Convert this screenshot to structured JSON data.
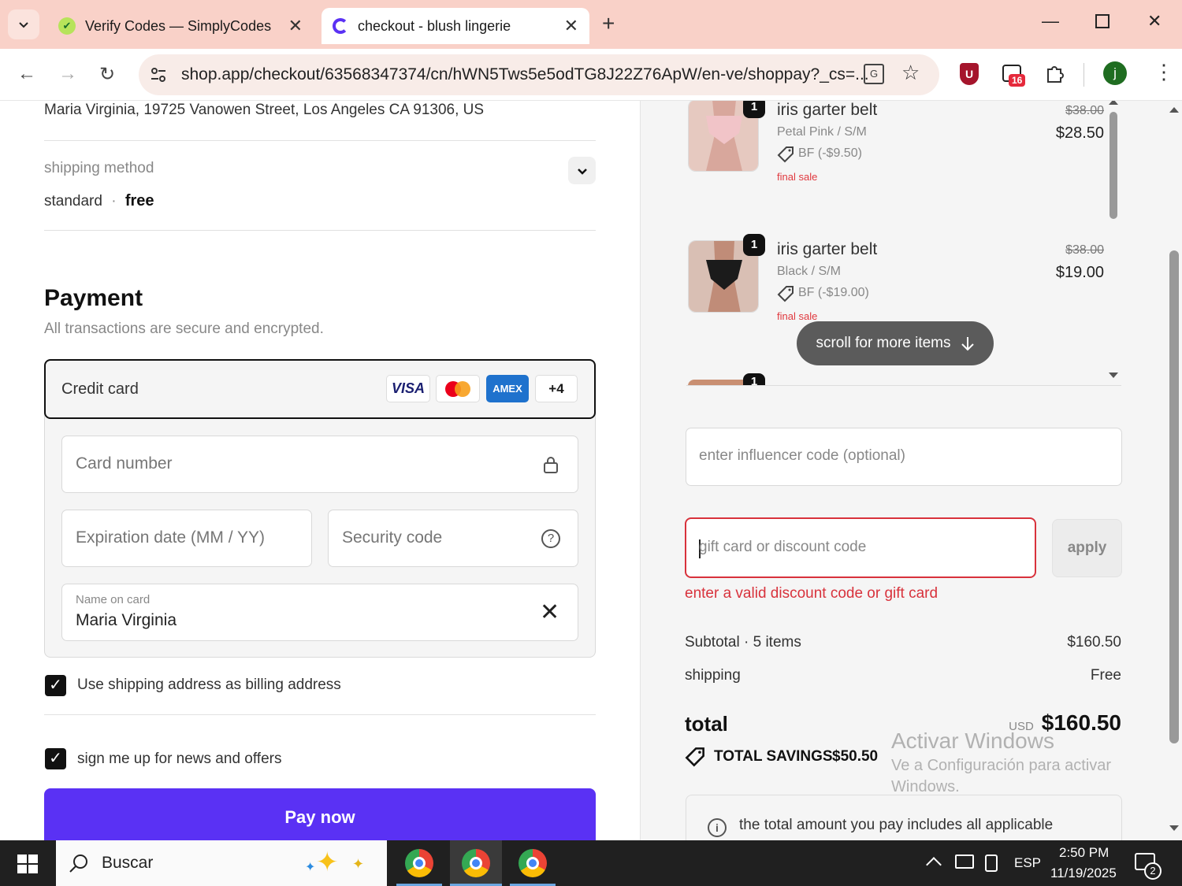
{
  "browser": {
    "tabs": [
      {
        "title": "Verify Codes — SimplyCodes",
        "favicon": "simplycodes-icon"
      },
      {
        "title": "checkout - blush lingerie",
        "favicon": "shop-icon"
      }
    ],
    "url": "shop.app/checkout/63568347374/cn/hWN5Tws5e5odTG8J22Z76ApW/en-ve/shoppay?_cs=...",
    "extension_badge": "16",
    "profile_letter": "j"
  },
  "checkout": {
    "address_line": "Maria Virginia, 19725 Vanowen Street, Los Angeles CA 91306, US",
    "shipping_method_label": "shipping method",
    "shipping_method_name": "standard",
    "shipping_method_sep": "·",
    "shipping_method_price": "free",
    "payment_heading": "Payment",
    "payment_subtitle": "All transactions are secure and encrypted.",
    "credit_card_label": "Credit card",
    "card_brands": [
      "VISA",
      "",
      "AMEX",
      "+4"
    ],
    "card_number_placeholder": "Card number",
    "expiration_placeholder": "Expiration date (MM / YY)",
    "security_placeholder": "Security code",
    "name_label": "Name on card",
    "name_value": "Maria Virginia",
    "billing_checkbox_label": "Use shipping address as billing address",
    "newsletter_checkbox_label": "sign me up for news and offers",
    "pay_button": "Pay now"
  },
  "summary": {
    "items": [
      {
        "qty": "1",
        "title": "iris garter belt",
        "variant": "Petal Pink / S/M",
        "discount": "BF (-$9.50)",
        "final": "final sale",
        "old_price": "$38.00",
        "price": "$28.50"
      },
      {
        "qty": "1",
        "title": "iris garter belt",
        "variant": "Black / S/M",
        "discount": "BF (-$19.00)",
        "final": "final sale",
        "old_price": "$38.00",
        "price": "$19.00"
      }
    ],
    "third_item_qty": "1",
    "scroll_hint": "scroll for more items",
    "influencer_placeholder": "enter influencer code (optional)",
    "discount_placeholder": "gift card or discount code",
    "apply_button": "apply",
    "discount_error": "enter a valid discount code or gift card",
    "subtotal_label": "Subtotal · 5 items",
    "subtotal_value": "$160.50",
    "shipping_label": "shipping",
    "shipping_value": "Free",
    "total_label": "total",
    "currency": "USD",
    "total_value": "$160.50",
    "savings_label": "TOTAL SAVINGS",
    "savings_value": "$50.50",
    "note": "the total amount you pay includes all applicable"
  },
  "watermark": {
    "title": "Activar Windows",
    "line1": "Ve a Configuración para activar",
    "line2": "Windows."
  },
  "taskbar": {
    "search_label": "Buscar",
    "lang": "ESP",
    "time": "2:50 PM",
    "date": "11/19/2025",
    "notif_count": "2"
  },
  "colors": {
    "tab_strip": "#f9d1c8",
    "pay_button": "#5a31f4",
    "error": "#d8323c"
  }
}
